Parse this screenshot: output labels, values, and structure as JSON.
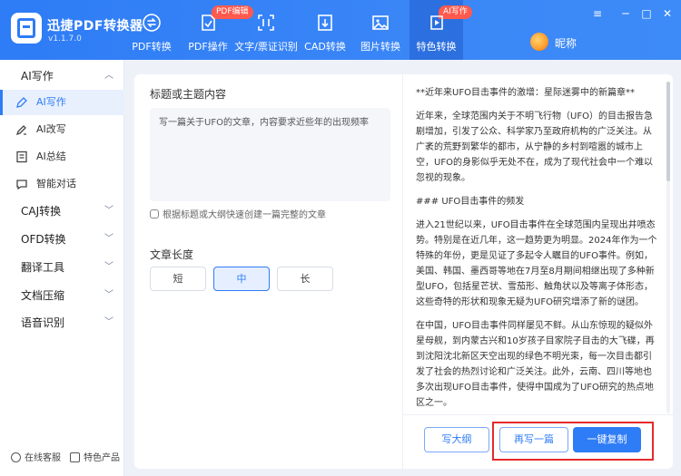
{
  "app": {
    "name": "迅捷PDF转换器",
    "version": "v1.1.7.0"
  },
  "nav": [
    {
      "label": "PDF转换",
      "icon": "pdf-convert-icon"
    },
    {
      "label": "PDF操作",
      "icon": "pdf-operation-icon",
      "badge": "PDF编辑"
    },
    {
      "label": "文字/票证识别",
      "icon": "ocr-icon"
    },
    {
      "label": "CAD转换",
      "icon": "cad-icon"
    },
    {
      "label": "图片转换",
      "icon": "image-icon"
    },
    {
      "label": "特色转换",
      "icon": "feature-icon",
      "badge": "AI写作",
      "active": true
    }
  ],
  "user": {
    "nickname": "昵称"
  },
  "window_controls": [
    "≡",
    "─",
    "□",
    "✕"
  ],
  "sidebar": {
    "groups": [
      {
        "label": "AI写作",
        "expanded": true,
        "items": [
          {
            "label": "AI写作",
            "icon": "pen-icon",
            "active": true
          },
          {
            "label": "AI改写",
            "icon": "rewrite-icon"
          },
          {
            "label": "AI总结",
            "icon": "summary-icon"
          },
          {
            "label": "智能对话",
            "icon": "chat-icon"
          }
        ]
      },
      {
        "label": "CAJ转换",
        "expanded": false
      },
      {
        "label": "OFD转换",
        "expanded": false
      },
      {
        "label": "翻译工具",
        "expanded": false
      },
      {
        "label": "文档压缩",
        "expanded": false
      },
      {
        "label": "语音识别",
        "expanded": false
      }
    ],
    "footer": {
      "service": "在线客服",
      "products": "特色产品"
    }
  },
  "editor": {
    "topic_label": "标题或主题内容",
    "topic_value": "写一篇关于UFO的文章，内容要求近些年的出现频率",
    "hint": "根据标题或大纲快速创建一篇完整的文章",
    "length_label": "文章长度",
    "length_options": [
      "短",
      "中",
      "长"
    ],
    "length_selected": "中"
  },
  "article": {
    "paragraphs": [
      "**近年来UFO目击事件的激增：星际迷雾中的新篇章**",
      "近年来，全球范围内关于不明飞行物（UFO）的目击报告急剧增加，引发了公众、科学家乃至政府机构的广泛关注。从广袤的荒野到繁华的都市，从宁静的乡村到喧嚣的城市上空，UFO的身影似乎无处不在，成为了现代社会中一个难以忽视的现象。",
      "### UFO目击事件的频发",
      "进入21世纪以来，UFO目击事件在全球范围内呈现出井喷态势。特别是在近几年，这一趋势更为明显。2024年作为一个特殊的年份，更是见证了多起令人瞩目的UFO事件。例如，美国、韩国、墨西哥等地在7月至8月期间相继出现了多种新型UFO，包括星芒状、雪茄形、触角状以及等离子体形态，这些奇特的形状和现象无疑为UFO研究增添了新的谜团。",
      "在中国，UFO目击事件同样屡见不鲜。从山东惊现的疑似外星母舰，到内蒙古兴和10岁孩子目家院子目击的大飞碟，再到沈阳沈北新区天空出现的绿色不明光束，每一次目击都引发了社会的热烈讨论和广泛关注。此外，云南、四川等地也多次出现UFO目击事件，使得中国成为了UFO研究的热点地区之一。"
    ]
  },
  "actions": {
    "outline": "写大纲",
    "rewrite": "再写一篇",
    "copy": "一键复制"
  },
  "colors": {
    "primary": "#2e7cf6",
    "badge": "#ff5a4e",
    "highlight_box": "#e52a2a"
  }
}
